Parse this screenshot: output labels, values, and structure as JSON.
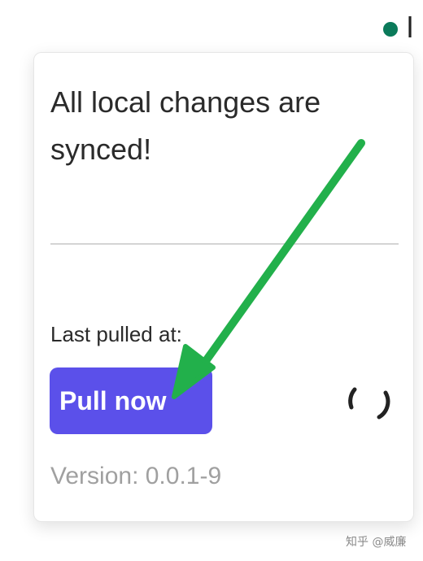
{
  "status": {
    "indicator_color": "#0b7a5a",
    "text": "l"
  },
  "popup": {
    "sync_message": "All local changes are synced!",
    "last_pulled_label": "Last pulled at:",
    "pull_button_label": "Pull now",
    "version_text": "Version: 0.0.1-9",
    "spinner_icon": "loading-spinner-icon"
  },
  "annotation": {
    "arrow_color": "#22b04b",
    "arrow_icon": "pointer-arrow-icon"
  },
  "watermark": {
    "text": "知乎 @威廉"
  },
  "colors": {
    "button_bg": "#5b50ea",
    "button_text": "#ffffff",
    "muted_text": "#a0a0a0"
  }
}
